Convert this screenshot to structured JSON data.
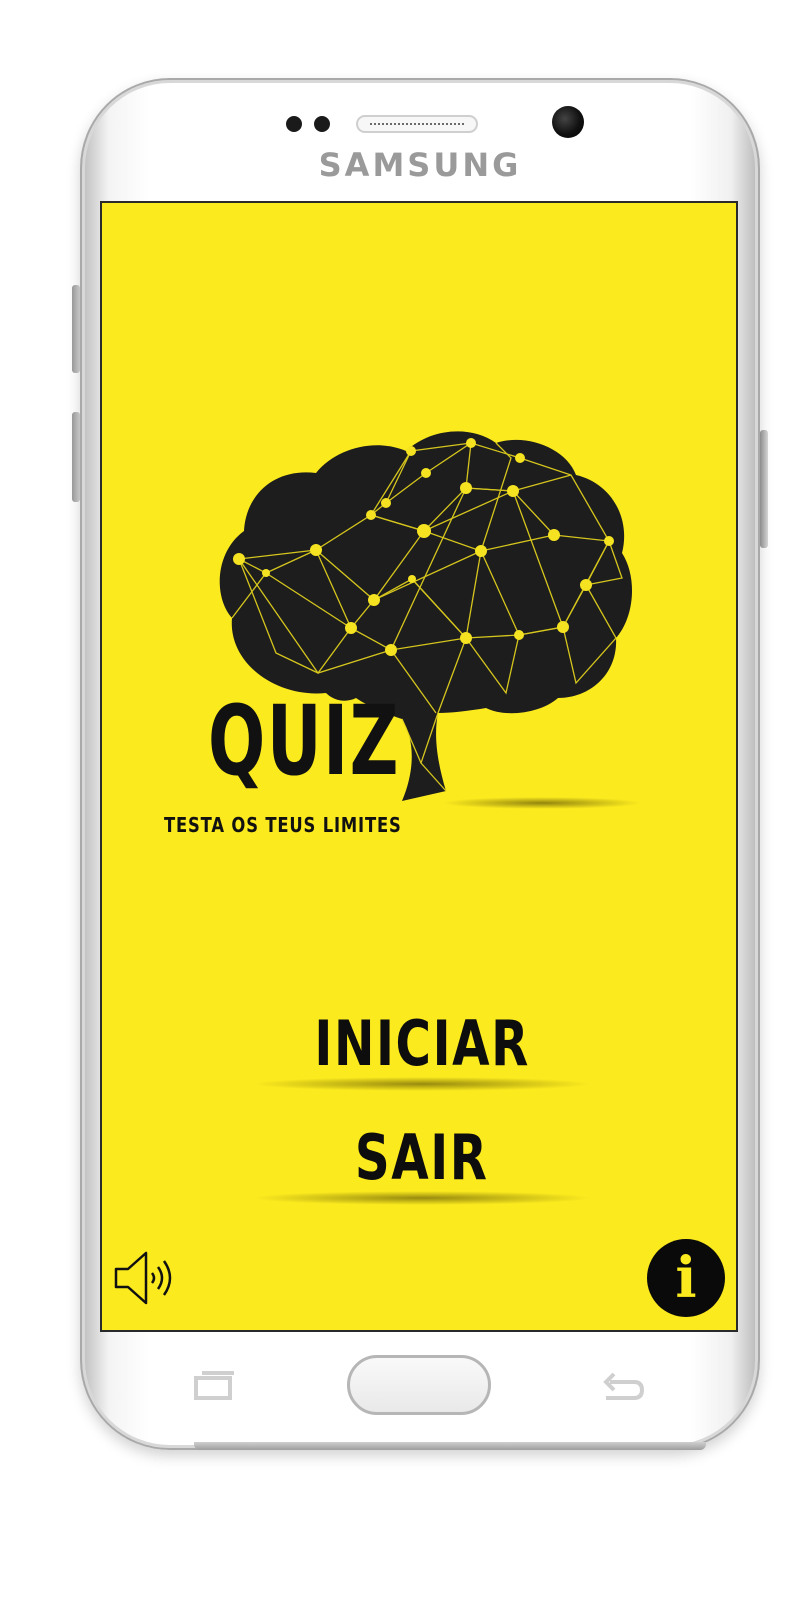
{
  "device": {
    "brand": "SAMSUNG",
    "model_icon": "smartphone-frame"
  },
  "app": {
    "logo": {
      "title": "QUIZ",
      "subtitle": "TESTA OS TEUS LIMITES",
      "icon": "brain-network-icon"
    },
    "menu": {
      "start_label": "INICIAR",
      "exit_label": "SAIR"
    },
    "controls": {
      "sound_icon": "speaker-volume-icon",
      "info_label": "i",
      "info_icon": "info-icon"
    },
    "colors": {
      "background": "#fbea1e",
      "foreground": "#111111"
    }
  },
  "nav_keys": {
    "recent_icon": "recent-apps-icon",
    "home_icon": "home-key",
    "back_icon": "back-icon"
  }
}
